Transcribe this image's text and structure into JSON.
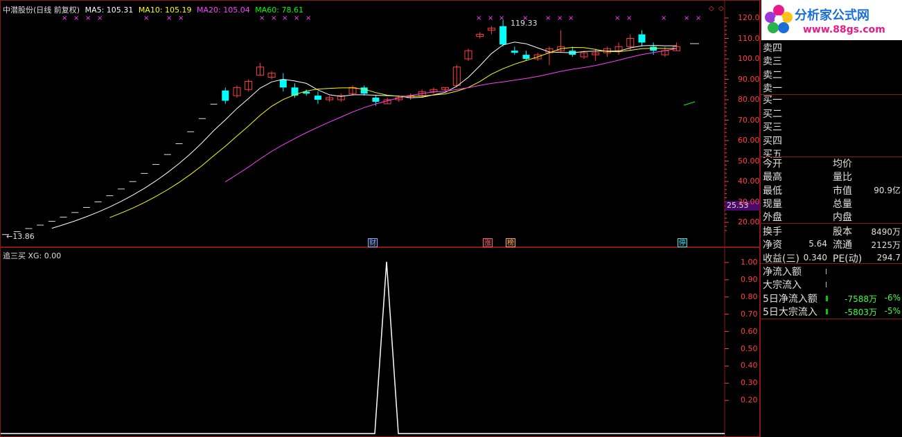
{
  "header": {
    "stock": "中潜股份(日线 前复权)",
    "ma5": "MA5: 105.31",
    "ma10": "MA10: 105.19",
    "ma20": "MA20: 105.04",
    "ma60": "MA60: 78.61"
  },
  "price_axis": [
    "120.00",
    "110.00",
    "100.00",
    "90.00",
    "80.00",
    "70.00",
    "60.00",
    "50.00",
    "40.00",
    "30.00",
    "20.00"
  ],
  "current_price_tag": "25.53",
  "labels": {
    "high": "119.33",
    "low": "13.86",
    "low_arrow": "←"
  },
  "events": [
    {
      "label": "财",
      "color": "#7fb0ff"
    },
    {
      "label": "涨",
      "color": "#ff6060"
    },
    {
      "label": "榜",
      "color": "#ffaa40"
    },
    {
      "label": "停",
      "color": "#40e0e0"
    }
  ],
  "indicator": {
    "title": "追三买 XG: 0.00",
    "axis": [
      "1.00",
      "0.90",
      "0.80",
      "0.70",
      "0.60",
      "0.50",
      "0.40",
      "0.30",
      "0.20"
    ]
  },
  "side": {
    "logo_text": "分析家公式网",
    "logo_url": "www.88gs.com",
    "sells": [
      "卖五",
      "卖四",
      "卖三",
      "卖二",
      "卖一"
    ],
    "buys": [
      "买一",
      "买二",
      "买三",
      "买四",
      "买五"
    ],
    "stats_left": [
      "今开",
      "最高",
      "最低",
      "现量",
      "外盘"
    ],
    "stats_right": [
      "均价",
      "量比",
      "市值",
      "总量",
      "内盘"
    ],
    "market_value": "90.9亿",
    "fund": [
      {
        "l": "换手",
        "lv": "",
        "r": "股本",
        "rv": "8490万"
      },
      {
        "l": "净资",
        "lv": "5.64",
        "r": "流通",
        "rv": "2125万"
      },
      {
        "l": "收益(三)",
        "lv": "0.340",
        "r": "PE(动)",
        "rv": "294.7"
      }
    ],
    "flows": [
      {
        "label": "净流入额",
        "value": "",
        "pct": ""
      },
      {
        "label": "大宗流入",
        "value": "",
        "pct": ""
      },
      {
        "label": "5日净流入额",
        "value": "-7588万",
        "pct": "-6%"
      },
      {
        "label": "5日大宗流入",
        "value": "-5803万",
        "pct": "-5%"
      }
    ]
  },
  "colors": {
    "up": "#ff4040",
    "down": "#00ffff",
    "ma5": "#ffffff",
    "ma10": "#ffff00",
    "ma20": "#ff40ff",
    "ma60": "#00ff00"
  }
}
